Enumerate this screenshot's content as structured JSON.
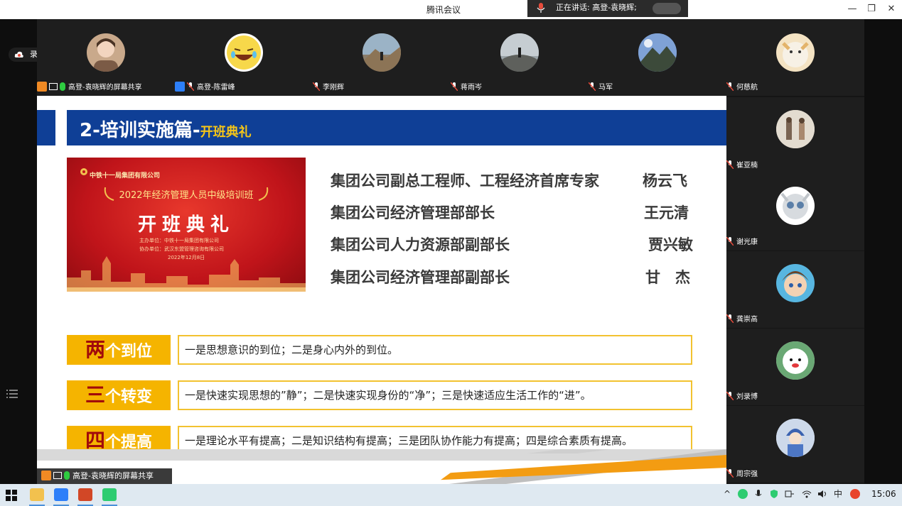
{
  "window": {
    "title": "腾讯会议",
    "speaking_label": "正在讲话: 高登-袁晓辉;",
    "minimize": "—",
    "restore": "❐",
    "close": "✕"
  },
  "recording_label": "录制中",
  "participants_top": [
    {
      "name": "高登-袁晓辉的屏幕共享",
      "avatar": "cartoon-couple",
      "color": "#c9a98b"
    },
    {
      "name": "高登-陈雷峰",
      "avatar": "laughing-emoji",
      "color": "#f7d84a"
    },
    {
      "name": "李刚辉",
      "avatar": "hiker-mountain",
      "color": "#8a7d6b"
    },
    {
      "name": "蒋雨岑",
      "avatar": "figure-on-rock",
      "color": "#9aa3a8"
    },
    {
      "name": "马军",
      "avatar": "mountain-sky",
      "color": "#6c88b5"
    },
    {
      "name": "何慈航",
      "avatar": "cartoon-animal",
      "color": "#e3b36a"
    }
  ],
  "participants_right": [
    {
      "name": "崔亚楠",
      "avatar": "couple-beach",
      "color": "#cfc4b6"
    },
    {
      "name": "谢光康",
      "avatar": "robot-cat",
      "color": "#d7dbdf"
    },
    {
      "name": "龚崇高",
      "avatar": "anime-boy",
      "color": "#7c5a3c"
    },
    {
      "name": "刘录博",
      "avatar": "white-bear",
      "color": "#e9e9e9"
    },
    {
      "name": "周宗强",
      "avatar": "figure-blue-hat",
      "color": "#4d77c5"
    }
  ],
  "slide": {
    "title": "2-培训实施篇-",
    "subtitle": "开班典礼",
    "banner": {
      "org": "中铁十一局集团有限公司",
      "class_name": "2022年经济管理人员中级培训班",
      "ceremony": "开班典礼",
      "host": "主办单位：中铁十一局集团有限公司",
      "co_host": "协办单位：武汉东盟管理咨询有限公司",
      "date": "2022年12月8日"
    },
    "leaders": [
      {
        "role": "集团公司副总工程师、工程经济首席专家",
        "name": "杨云飞"
      },
      {
        "role": "集团公司经济管理部部长",
        "name": "王元清"
      },
      {
        "role": "集团公司人力资源部副部长",
        "name": "贾兴敏"
      },
      {
        "role": "集团公司经济管理部副部长",
        "name": "甘　杰"
      }
    ],
    "points": [
      {
        "big": "两",
        "rest": "个到位",
        "text": "一是思想意识的到位；二是身心内外的到位。"
      },
      {
        "big": "三",
        "rest": "个转变",
        "text": "一是快速实现思想的”静”；二是快速实现身份的“净”；三是快速适应生活工作的“进”。"
      },
      {
        "big": "四",
        "rest": "个提高",
        "text": "一是理论水平有提高；二是知识结构有提高；三是团队协作能力有提高；四是综合素质有提高。"
      }
    ]
  },
  "share_bar_label": "高登-袁晓辉的屏幕共享",
  "taskbar": {
    "clock": "15:06",
    "tray_ime": "中"
  },
  "colors": {
    "slide_header": "#0f3f96",
    "accent_gold": "#f5b400",
    "point_red": "#a10a0a"
  }
}
